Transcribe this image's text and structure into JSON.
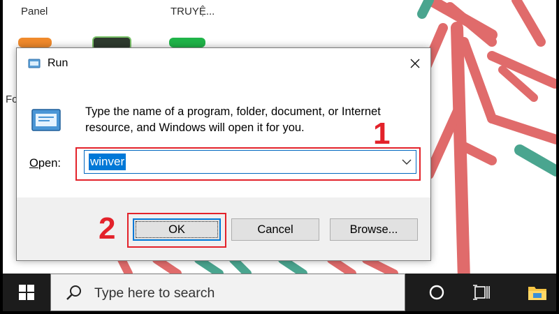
{
  "desktop": {
    "labels": [
      "Panel",
      "TRUYỆ...",
      "Fo"
    ],
    "accent_colors": {
      "wallpaper_red": "#e06b6b",
      "wallpaper_teal": "#4aa58f"
    }
  },
  "run_dialog": {
    "title": "Run",
    "title_icon": "run-icon",
    "close_icon": "close-icon",
    "description": "Type the name of a program, folder, document, or Internet resource, and Windows will open it for you.",
    "open_label_access_key": "O",
    "open_label_rest": "pen:",
    "open_value": "winver",
    "buttons": {
      "ok": "OK",
      "cancel": "Cancel",
      "browse": "Browse..."
    }
  },
  "annotations": {
    "step1": "1",
    "step2": "2",
    "highlight_color": "#e3222a"
  },
  "taskbar": {
    "start_icon": "windows-logo-icon",
    "search_placeholder": "Type here to search",
    "cortana_icon": "cortana-circle-icon",
    "taskview_icon": "task-view-icon",
    "explorer_icon": "file-explorer-icon"
  }
}
